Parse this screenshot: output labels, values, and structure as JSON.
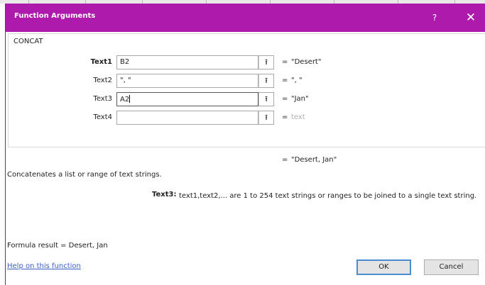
{
  "dialog": {
    "title": "Function Arguments",
    "help_glyph": "?",
    "close_glyph": "✕",
    "function_name": "CONCAT"
  },
  "arguments": [
    {
      "label": "Text1",
      "value": "B2",
      "result": "\"Desert\"",
      "equals": "=",
      "ref_glyph": "⭱"
    },
    {
      "label": "Text2",
      "value": "\", \"",
      "result": "\", \"",
      "equals": "=",
      "ref_glyph": "⭱"
    },
    {
      "label": "Text3",
      "value": "A2",
      "result": "\"Jan\"",
      "equals": "=",
      "ref_glyph": "⭱"
    },
    {
      "label": "Text4",
      "value": "",
      "result": "text",
      "equals": "=",
      "ref_glyph": "⭱"
    }
  ],
  "overall": {
    "equals": "=",
    "result": "\"Desert, Jan\""
  },
  "description": "Concatenates a list or range of text strings.",
  "argument_help": {
    "name": "Text3:",
    "text": "text1,text2,... are 1 to 254 text strings or ranges to be joined to a single text string."
  },
  "formula_result": "Formula result = Desert, Jan",
  "help_link": "Help on this function",
  "buttons": {
    "ok": "OK",
    "cancel": "Cancel"
  },
  "colors": {
    "titlebar": "#ad1aac",
    "link": "#3b5fc4"
  }
}
